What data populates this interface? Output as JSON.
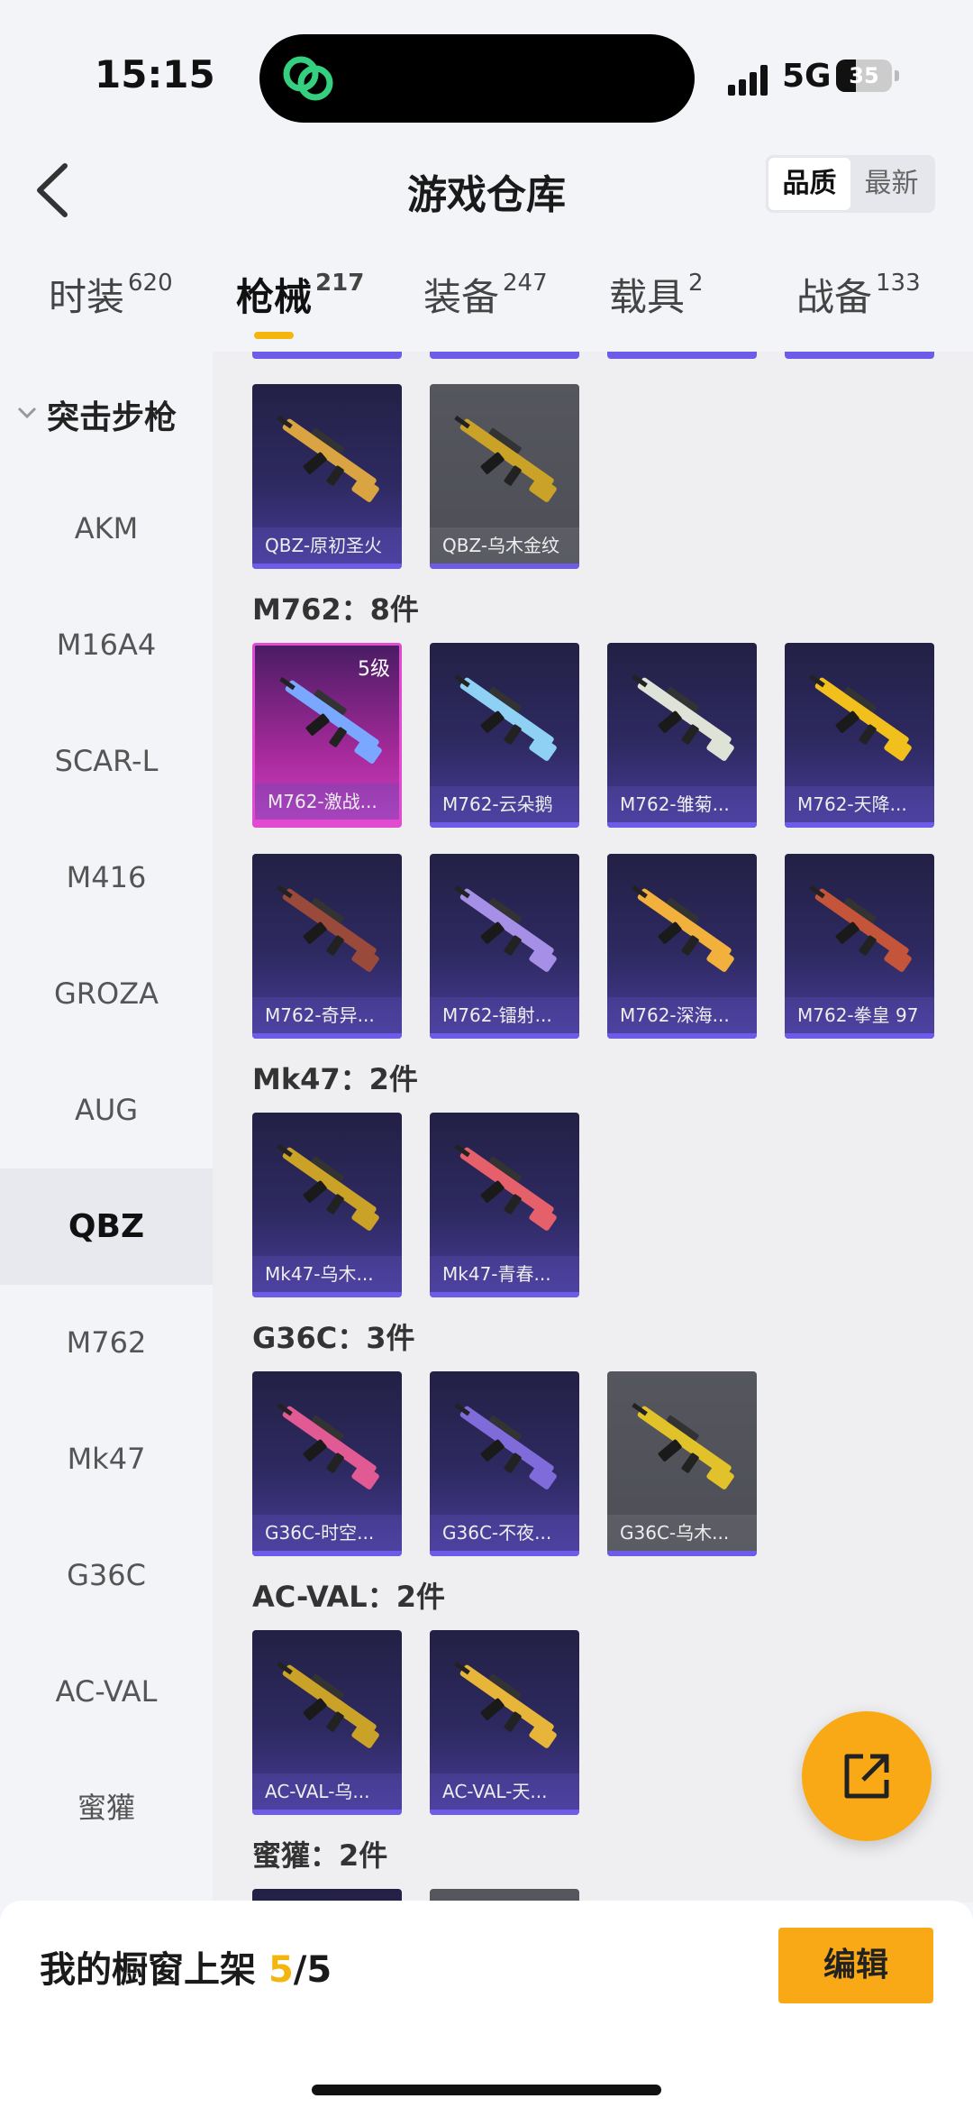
{
  "status": {
    "time": "15:15",
    "network": "5G",
    "battery": "35",
    "battery_level": 0.35
  },
  "header": {
    "title": "游戏仓库",
    "sort_options": [
      "品质",
      "最新"
    ],
    "sort_selected": 0
  },
  "tabs": [
    {
      "label": "时装",
      "count": "620"
    },
    {
      "label": "枪械",
      "count": "217"
    },
    {
      "label": "装备",
      "count": "247"
    },
    {
      "label": "载具",
      "count": "2"
    },
    {
      "label": "战备",
      "count": "133"
    }
  ],
  "sidebar": {
    "category": "突击步枪",
    "items": [
      "AKM",
      "M16A4",
      "SCAR-L",
      "M416",
      "GROZA",
      "AUG",
      "QBZ",
      "M762",
      "Mk47",
      "G36C",
      "AC-VAL",
      "蜜獾"
    ],
    "selected": "QBZ"
  },
  "sections": [
    {
      "label": "",
      "items": [
        {
          "name": "QBZ-原初圣火",
          "style": "purple",
          "color": "#d9a441"
        },
        {
          "name": "QBZ-乌木金纹",
          "style": "gray",
          "color": "#c9a227"
        }
      ]
    },
    {
      "label": "M762：8件",
      "items": [
        {
          "name": "M762-激战...",
          "style": "pink",
          "level": "5级",
          "color": "#7aa7ff"
        },
        {
          "name": "M762-云朵鹅",
          "style": "purple",
          "color": "#8fd0f5"
        },
        {
          "name": "M762-雏菊...",
          "style": "purple",
          "color": "#dfe2d6"
        },
        {
          "name": "M762-天降...",
          "style": "purple",
          "color": "#f2c01d"
        },
        {
          "name": "M762-奇异...",
          "style": "purple",
          "color": "#9a4a3a"
        },
        {
          "name": "M762-镭射...",
          "style": "purple",
          "color": "#a68fe6"
        },
        {
          "name": "M762-深海...",
          "style": "purple",
          "color": "#f2b13c"
        },
        {
          "name": "M762-拳皇 97",
          "style": "purple",
          "color": "#c4553a"
        }
      ]
    },
    {
      "label": "Mk47：2件",
      "items": [
        {
          "name": "Mk47-乌木...",
          "style": "purple",
          "color": "#c9a227"
        },
        {
          "name": "Mk47-青春...",
          "style": "purple",
          "color": "#e5606a"
        }
      ]
    },
    {
      "label": "G36C：3件",
      "items": [
        {
          "name": "G36C-时空...",
          "style": "purple",
          "color": "#e25a93"
        },
        {
          "name": "G36C-不夜...",
          "style": "purple",
          "color": "#7f6bd9"
        },
        {
          "name": "G36C-乌木...",
          "style": "gray",
          "color": "#e2c22a"
        }
      ]
    },
    {
      "label": "AC-VAL：2件",
      "items": [
        {
          "name": "AC-VAL-乌...",
          "style": "purple",
          "color": "#c9a227"
        },
        {
          "name": "AC-VAL-天...",
          "style": "purple",
          "color": "#e7b53a"
        }
      ]
    },
    {
      "label": "蜜獾：2件",
      "items": []
    }
  ],
  "bottom": {
    "label_prefix": "我的橱窗上架 ",
    "count_on": "5",
    "count_total": "/5",
    "edit_label": "编辑"
  },
  "colors": {
    "accent": "#f9a915",
    "card_purple": "#2e2a62",
    "card_pink": "#d43fc6"
  }
}
